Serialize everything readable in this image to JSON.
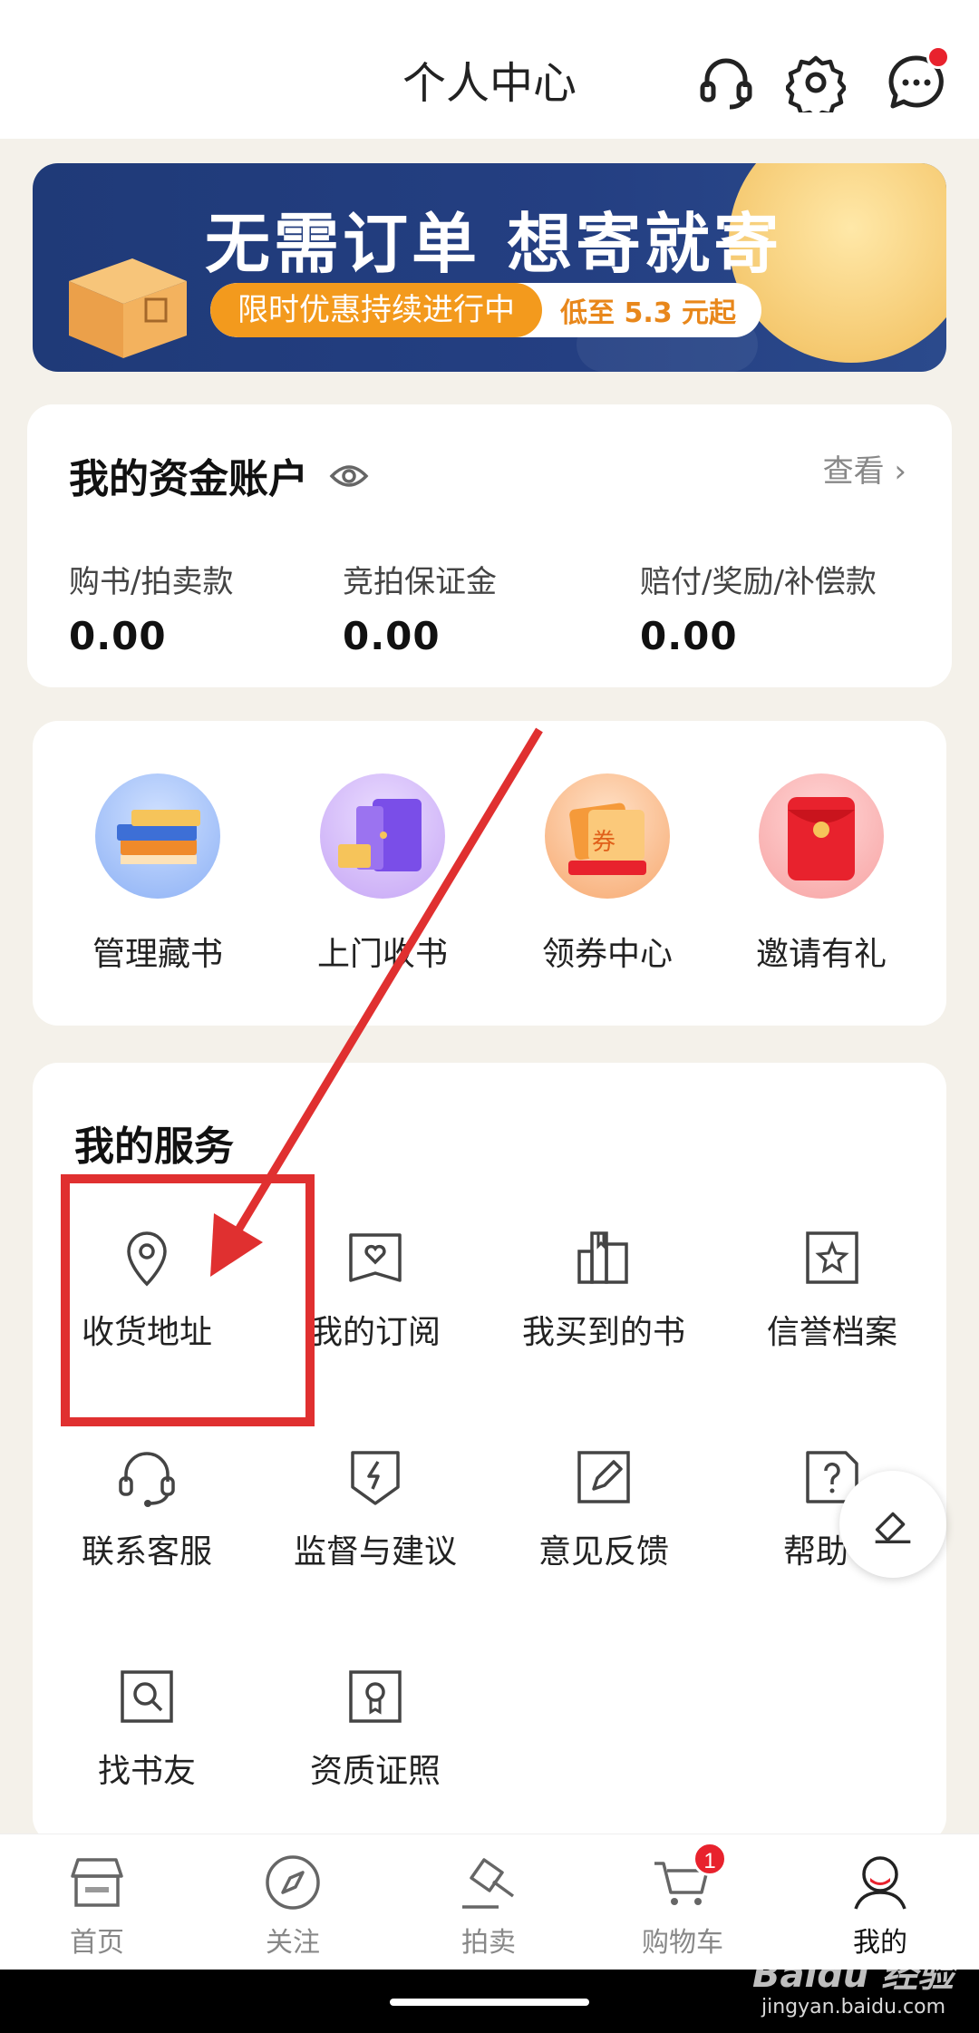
{
  "header": {
    "title": "个人中心",
    "icons": [
      "headset-icon",
      "settings-icon",
      "message-icon"
    ]
  },
  "banner": {
    "headline": "无需订单  想寄就寄",
    "promo": "限时优惠持续进行中",
    "price": "低至 5.3 元起"
  },
  "funds": {
    "title": "我的资金账户",
    "view_label": "查看 ›",
    "items": [
      {
        "label": "购书/拍卖款",
        "value": "0.00"
      },
      {
        "label": "竞拍保证金",
        "value": "0.00"
      },
      {
        "label": "赔付/奖励/补偿款",
        "value": "0.00"
      }
    ]
  },
  "quick": [
    {
      "label": "管理藏书",
      "icon": "books-icon"
    },
    {
      "label": "上门收书",
      "icon": "door-pickup-icon"
    },
    {
      "label": "领券中心",
      "icon": "coupon-icon"
    },
    {
      "label": "邀请有礼",
      "icon": "red-envelope-icon"
    }
  ],
  "services": {
    "title": "我的服务",
    "items": [
      {
        "label": "收货地址",
        "icon": "location-pin-icon"
      },
      {
        "label": "我的订阅",
        "icon": "subscription-icon"
      },
      {
        "label": "我买到的书",
        "icon": "purchased-books-icon"
      },
      {
        "label": "信誉档案",
        "icon": "credit-record-icon"
      },
      {
        "label": "联系客服",
        "icon": "customer-service-icon"
      },
      {
        "label": "监督与建议",
        "icon": "shield-lightning-icon"
      },
      {
        "label": "意见反馈",
        "icon": "feedback-edit-icon"
      },
      {
        "label": "帮助中",
        "icon": "help-icon"
      },
      {
        "label": "找书友",
        "icon": "find-friend-icon"
      },
      {
        "label": "资质证照",
        "icon": "certificate-icon"
      }
    ]
  },
  "tabs": [
    {
      "label": "首页",
      "icon": "home-icon"
    },
    {
      "label": "关注",
      "icon": "compass-icon"
    },
    {
      "label": "拍卖",
      "icon": "auction-hammer-icon"
    },
    {
      "label": "购物车",
      "icon": "cart-icon",
      "badge": "1"
    },
    {
      "label": "我的",
      "icon": "profile-icon",
      "active": true
    }
  ],
  "watermark": {
    "brand": "Baidu 经验",
    "url": "jingyan.baidu.com"
  },
  "colors": {
    "accent": "#e8222d",
    "banner_bg": "#1f3a78",
    "page_bg": "#f4f1ea",
    "annotation_red": "#e03030"
  }
}
